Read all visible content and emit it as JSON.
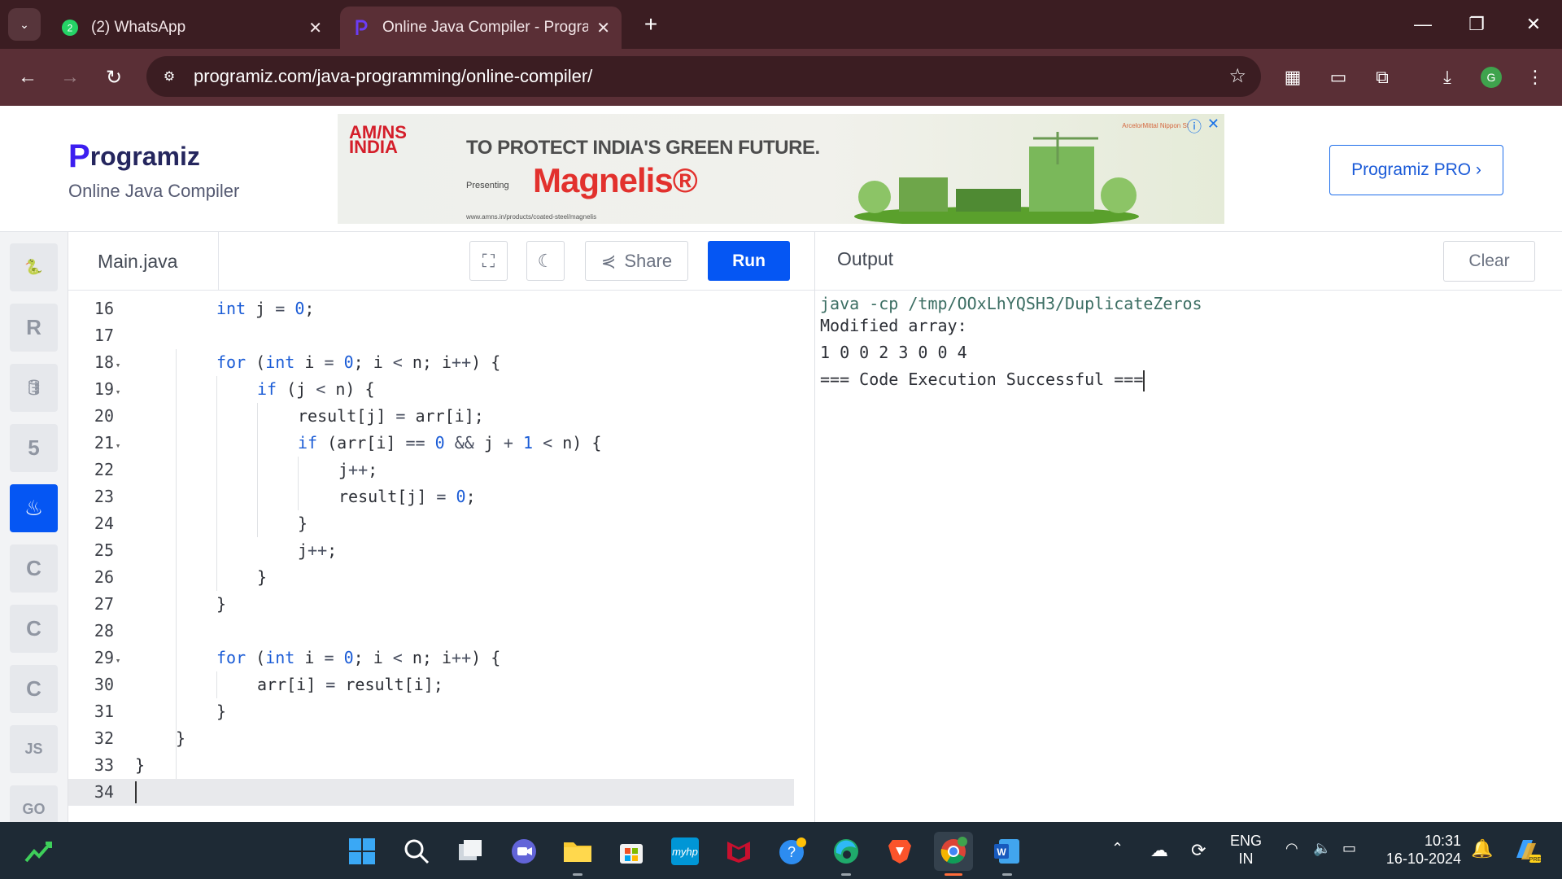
{
  "browser": {
    "tabs": [
      {
        "title": "(2) WhatsApp",
        "icon": "whatsapp-icon"
      },
      {
        "title": "Online Java Compiler - Programiz",
        "icon": "programiz-icon",
        "active": true
      }
    ],
    "url": "programiz.com/java-programming/online-compiler/"
  },
  "header": {
    "logo": "rogramiz",
    "logo_letter": "P",
    "subtitle": "Online Java Compiler",
    "pro_button": "Programiz PRO ›"
  },
  "ad": {
    "brand": "AM/NS INDIA",
    "headline": "TO PROTECT INDIA'S GREEN FUTURE.",
    "presenting": "Presenting",
    "product": "Magnelis®",
    "web": "www.amns.in/products/coated-steel/magnelis",
    "advertiser": "ArcelorMittal Nippon St"
  },
  "sidebar": {
    "languages": [
      {
        "name": "python-icon",
        "glyph": "🐍"
      },
      {
        "name": "r-icon",
        "glyph": "R"
      },
      {
        "name": "sql-icon",
        "glyph": "🛢"
      },
      {
        "name": "html5-icon",
        "glyph": "5"
      },
      {
        "name": "java-icon",
        "glyph": "♨",
        "active": true
      },
      {
        "name": "c-icon",
        "glyph": "C"
      },
      {
        "name": "cpp-icon",
        "glyph": "C"
      },
      {
        "name": "csharp-icon",
        "glyph": "C"
      },
      {
        "name": "js-icon",
        "glyph": "JS"
      },
      {
        "name": "go-icon",
        "glyph": "GO"
      }
    ]
  },
  "editor": {
    "filename": "Main.java",
    "share_label": "Share",
    "run_label": "Run",
    "lines": [
      {
        "n": "16",
        "fold": false,
        "indent": 2,
        "code": "int j = 0;"
      },
      {
        "n": "17",
        "fold": false,
        "indent": 0,
        "code": ""
      },
      {
        "n": "18",
        "fold": true,
        "indent": 2,
        "code": "for (int i = 0; i < n; i++) {"
      },
      {
        "n": "19",
        "fold": true,
        "indent": 3,
        "code": "if (j < n) {"
      },
      {
        "n": "20",
        "fold": false,
        "indent": 4,
        "code": "result[j] = arr[i];"
      },
      {
        "n": "21",
        "fold": true,
        "indent": 4,
        "code": "if (arr[i] == 0 && j + 1 < n) {"
      },
      {
        "n": "22",
        "fold": false,
        "indent": 5,
        "code": "j++;"
      },
      {
        "n": "23",
        "fold": false,
        "indent": 5,
        "code": "result[j] = 0;"
      },
      {
        "n": "24",
        "fold": false,
        "indent": 4,
        "code": "}"
      },
      {
        "n": "25",
        "fold": false,
        "indent": 4,
        "code": "j++;"
      },
      {
        "n": "26",
        "fold": false,
        "indent": 3,
        "code": "}"
      },
      {
        "n": "27",
        "fold": false,
        "indent": 2,
        "code": "}"
      },
      {
        "n": "28",
        "fold": false,
        "indent": 0,
        "code": ""
      },
      {
        "n": "29",
        "fold": true,
        "indent": 2,
        "code": "for (int i = 0; i < n; i++) {"
      },
      {
        "n": "30",
        "fold": false,
        "indent": 3,
        "code": "arr[i] = result[i];"
      },
      {
        "n": "31",
        "fold": false,
        "indent": 2,
        "code": "}"
      },
      {
        "n": "32",
        "fold": false,
        "indent": 1,
        "code": "}"
      },
      {
        "n": "33",
        "fold": false,
        "indent": 0,
        "code": "}"
      },
      {
        "n": "34",
        "fold": false,
        "indent": 0,
        "code": ""
      }
    ]
  },
  "output": {
    "title": "Output",
    "clear_label": "Clear",
    "lines": [
      "java -cp /tmp/OOxLhYQSH3/DuplicateZeros",
      "Modified array:",
      "1 0 0 2 3 0 0 4",
      "=== Code Execution Successful ==="
    ]
  },
  "taskbar": {
    "apps": [
      "start-icon",
      "search-icon",
      "task-view-icon",
      "meet-icon",
      "file-explorer-icon",
      "store-icon",
      "myhp-icon",
      "mcafee-icon",
      "help-icon",
      "edge-icon",
      "brave-icon",
      "chrome-icon",
      "word-icon"
    ],
    "language": "ENG",
    "region": "IN",
    "time": "10:31",
    "date": "16-10-2024"
  },
  "colors": {
    "accent": "#0556f3",
    "chrome_dark": "#3b1d22",
    "chrome": "#5a2f36",
    "keyword": "#1b5cd6"
  }
}
